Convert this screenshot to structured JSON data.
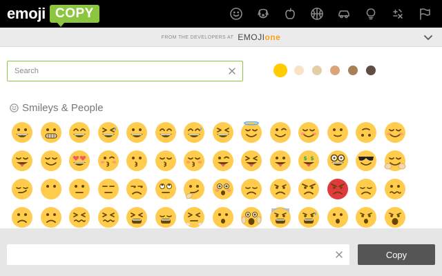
{
  "header": {
    "logo_word": "emoji",
    "logo_badge": "COPY",
    "categories": [
      {
        "icon": "smiley-icon",
        "name": "smileys"
      },
      {
        "icon": "dog-face-icon",
        "name": "nature"
      },
      {
        "icon": "apple-icon",
        "name": "food"
      },
      {
        "icon": "basketball-icon",
        "name": "activity"
      },
      {
        "icon": "car-icon",
        "name": "travel"
      },
      {
        "icon": "lightbulb-icon",
        "name": "objects"
      },
      {
        "icon": "symbols-icon",
        "name": "symbols"
      },
      {
        "icon": "flag-icon",
        "name": "flags"
      }
    ]
  },
  "devbar": {
    "prefix": "FROM THE DEVELOPERS AT",
    "brand_main": "EMOJI",
    "brand_accent": "one",
    "collapse_icon": "chevron-down-icon"
  },
  "search": {
    "placeholder": "Search",
    "value": ""
  },
  "skin_tones": {
    "colors": [
      "#ffcc00",
      "#fae3c5",
      "#e2cfa5",
      "#daa478",
      "#a78058",
      "#5e4d43"
    ],
    "selected": 0
  },
  "section": {
    "title": "Smileys & People",
    "icon": "smiley-outline-icon"
  },
  "emojis": [
    [
      "grinning",
      "grimacing",
      "grin",
      "joy",
      "smiley",
      "smile",
      "sweat-smile",
      "laughing",
      "innocent",
      "wink",
      "blush",
      "slight-smile",
      "upside-down",
      "relaxed"
    ],
    [
      "yum",
      "relieved",
      "heart-eyes",
      "kissing-heart",
      "kissing",
      "kissing-smiling",
      "kissing-closed-eyes",
      "stuck-out-tongue-winking",
      "stuck-out-tongue-closed-eyes",
      "stuck-out-tongue",
      "money-mouth",
      "nerd",
      "sunglasses",
      "hugging"
    ],
    [
      "smirk",
      "no-mouth",
      "neutral",
      "expressionless",
      "unamused",
      "rolling-eyes",
      "thinking",
      "flushed",
      "disappointed",
      "worried",
      "angry",
      "rage",
      "pensive",
      "confused"
    ],
    [
      "slight-frown",
      "frowning2",
      "persevere",
      "confounded",
      "tired",
      "weary",
      "triumph",
      "open-mouth",
      "scream",
      "fearful",
      "cold-sweat",
      "hushed",
      "frowning",
      "anguished"
    ]
  ],
  "colors": {
    "accent": "#8cc63f",
    "brand_orange": "#f8a01c",
    "emoji_yellow": "#ffcc4d",
    "copy_button": "#555555"
  },
  "output": {
    "value": "",
    "placeholder": "",
    "clear_icon": "close-icon",
    "copy_label": "Copy"
  }
}
